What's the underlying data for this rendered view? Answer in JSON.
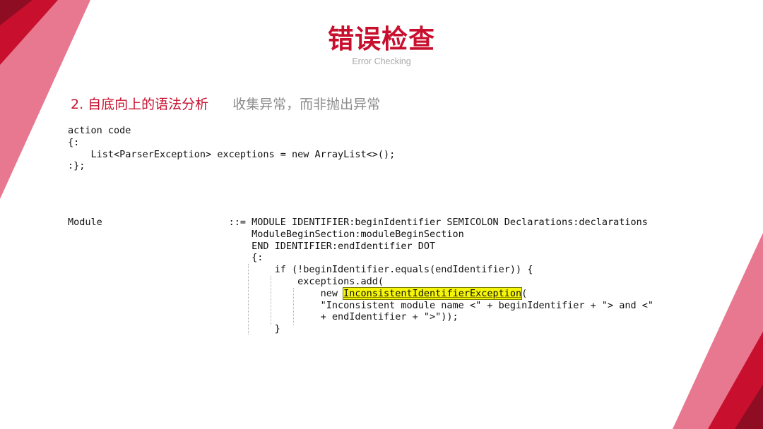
{
  "slide": {
    "title": "错误检查",
    "subtitle": "Error Checking",
    "heading_number": "2. 自底向上的语法分析",
    "heading_note": "收集异常，而非抛出异常"
  },
  "colors": {
    "accent": "#c8102e",
    "pink": "#e56b83",
    "highlight": "#f5f50a"
  },
  "action_code": [
    "action code",
    "{:",
    "    List<ParserException> exceptions = new ArrayList<>();",
    ":};"
  ],
  "module_code": {
    "line1": "Module                      ::= MODULE IDENTIFIER:beginIdentifier SEMICOLON Declarations:declarations",
    "line2": "                                ModuleBeginSection:moduleBeginSection",
    "line3": "                                END IDENTIFIER:endIdentifier DOT",
    "line4": "                                {:",
    "line5": "                                    if (!beginIdentifier.equals(endIdentifier)) {",
    "line6": "                                        exceptions.add(",
    "line7_prefix": "                                            new ",
    "line7_highlight": "InconsistentIdentifierException",
    "line7_suffix": "(",
    "line8": "                                            \"Inconsistent module name <\" + beginIdentifier + \"> and <\"",
    "line9": "                                            + endIdentifier + \">\"));",
    "line10": "                                    }"
  }
}
